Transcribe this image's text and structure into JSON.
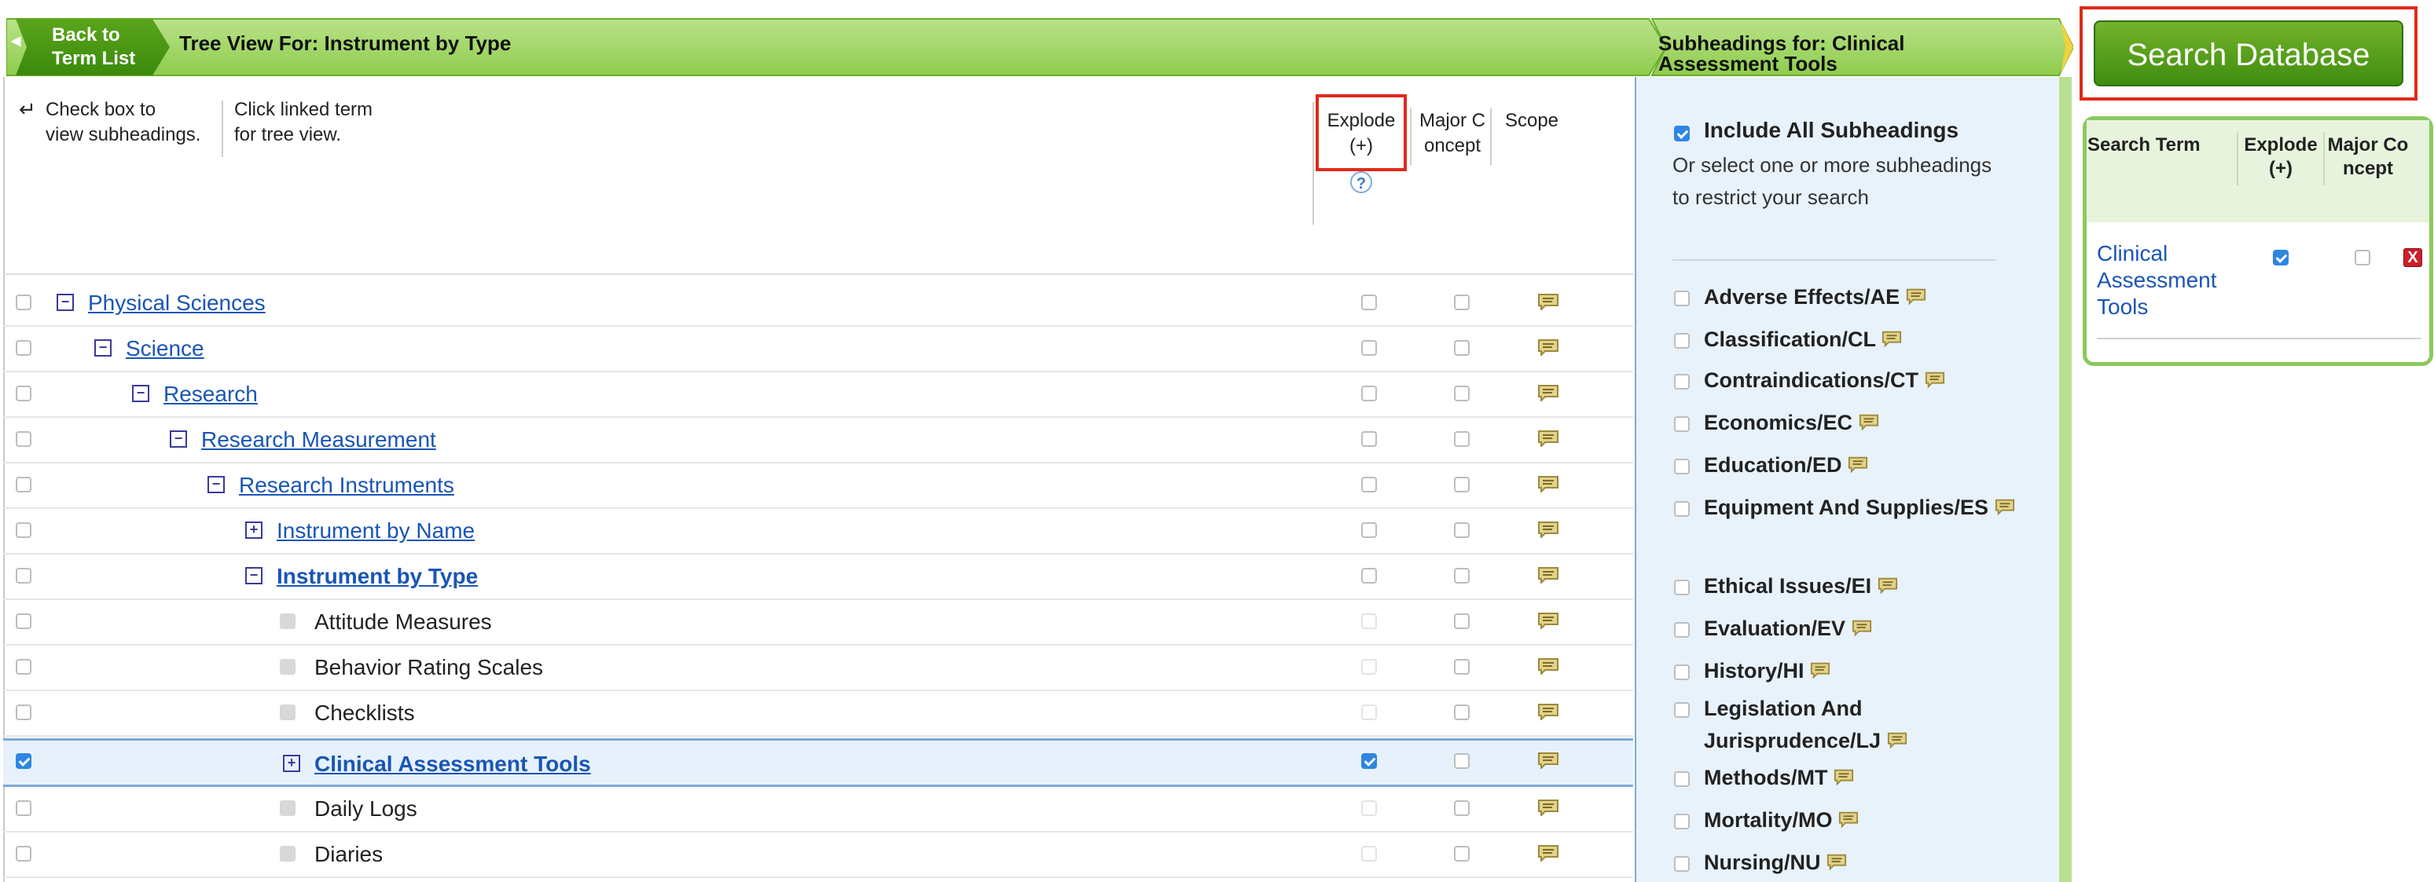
{
  "header": {
    "back_line1": "Back to",
    "back_line2": "Term List",
    "tree_title": "Tree View For: Instrument by Type",
    "subheadings_title_line1": "Subheadings for: Clinical",
    "subheadings_title_line2": "Assessment Tools",
    "search_button": "Search Database"
  },
  "hints": {
    "check_line1": "Check box to",
    "check_line2": "view subheadings.",
    "click_line1": "Click linked term",
    "click_line2": "for tree view."
  },
  "columns": {
    "explode_line1": "Explode",
    "explode_line2": "(+)",
    "major_line1": "Major C",
    "major_line2": "oncept",
    "scope": "Scope",
    "help": "?"
  },
  "tree_rows": [
    {
      "label": "Physical Sciences",
      "toggle": "−",
      "type": "link",
      "checked": false,
      "explode": false
    },
    {
      "label": "Science",
      "toggle": "−",
      "type": "link",
      "checked": false,
      "explode": false
    },
    {
      "label": "Research",
      "toggle": "−",
      "type": "link",
      "checked": false,
      "explode": false
    },
    {
      "label": "Research Measurement",
      "toggle": "−",
      "type": "link",
      "checked": false,
      "explode": false
    },
    {
      "label": "Research Instruments",
      "toggle": "−",
      "type": "link",
      "checked": false,
      "explode": false
    },
    {
      "label": "Instrument by Name",
      "toggle": "+",
      "type": "link",
      "checked": false,
      "explode": false
    },
    {
      "label": "Instrument by Type",
      "toggle": "−",
      "type": "link-bold",
      "checked": false,
      "explode": false
    },
    {
      "label": "Attitude Measures",
      "toggle": "",
      "type": "leaf",
      "checked": false,
      "explode": false
    },
    {
      "label": "Behavior Rating Scales",
      "toggle": "",
      "type": "leaf",
      "checked": false,
      "explode": false
    },
    {
      "label": "Checklists",
      "toggle": "",
      "type": "leaf",
      "checked": false,
      "explode": false
    },
    {
      "label": "Clinical Assessment Tools",
      "toggle": "+",
      "type": "link-bold",
      "checked": true,
      "explode": true
    },
    {
      "label": "Daily Logs",
      "toggle": "",
      "type": "leaf",
      "checked": false,
      "explode": false
    },
    {
      "label": "Diaries",
      "toggle": "",
      "type": "leaf",
      "checked": false,
      "explode": false
    }
  ],
  "subheadings": {
    "include_all": "Include All Subheadings",
    "include_all_checked": true,
    "description": "Or select one or more subheadings to restrict your search",
    "items": [
      {
        "label": "Adverse Effects/AE"
      },
      {
        "label": "Classification/CL"
      },
      {
        "label": "Contraindications/CT"
      },
      {
        "label": "Economics/EC"
      },
      {
        "label": "Education/ED"
      },
      {
        "label": "Equipment And Supplies/ES"
      },
      {
        "label": "Ethical Issues/EI"
      },
      {
        "label": "Evaluation/EV"
      },
      {
        "label": "History/HI"
      },
      {
        "label": "Legislation And Jurisprudence/LJ"
      },
      {
        "label": "Methods/MT"
      },
      {
        "label": "Mortality/MO"
      },
      {
        "label": "Nursing/NU"
      }
    ]
  },
  "selected": {
    "col_term": "Search Term",
    "col_explode_line1": "Explode",
    "col_explode_line2": "(+)",
    "col_major_line1": "Major Co",
    "col_major_line2": "ncept",
    "term": "Clinical Assessment Tools",
    "explode_checked": true,
    "major_checked": false,
    "remove": "X"
  },
  "colors": {
    "banner_green": "#7cbf2f",
    "link": "#1a55b5",
    "highlight_red": "#e02a1a",
    "checkbox_blue": "#2d86e3"
  }
}
